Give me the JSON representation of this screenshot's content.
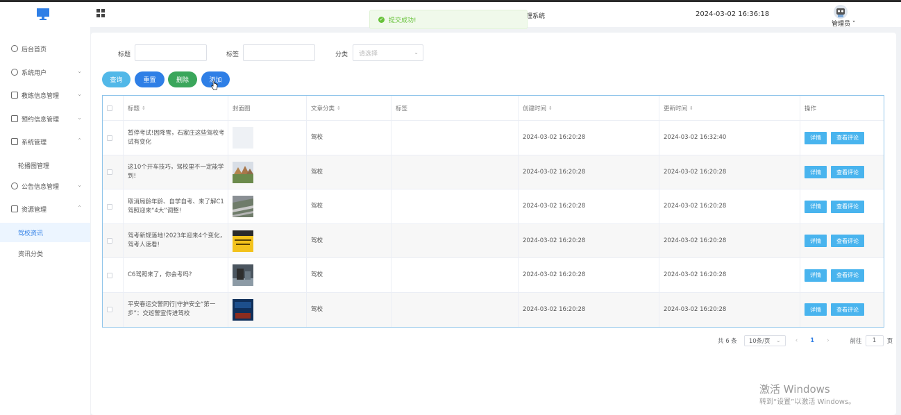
{
  "header": {
    "system_title": "理系统",
    "datetime": "2024-03-02 16:36:18",
    "user_name": "管理员 ˅"
  },
  "toast": {
    "text": "提交成功!"
  },
  "sidebar": {
    "items": [
      {
        "label": "后台首页"
      },
      {
        "label": "系统用户"
      },
      {
        "label": "教练信息管理"
      },
      {
        "label": "预约信息管理"
      },
      {
        "label": "系统管理"
      },
      {
        "label": "公告信息管理"
      },
      {
        "label": "资源管理"
      }
    ],
    "subitems": [
      {
        "label": "轮播图管理"
      },
      {
        "label": "驾校资讯"
      },
      {
        "label": "资讯分类"
      }
    ]
  },
  "filters": {
    "title_label": "标题",
    "tag_label": "标签",
    "category_label": "分类",
    "category_placeholder": "请选择"
  },
  "actions": {
    "query": "查询",
    "reset": "重置",
    "delete": "删除",
    "add": "添加"
  },
  "table": {
    "headers": {
      "title": "标题",
      "cover": "封面图",
      "category": "文章分类",
      "tags": "标签",
      "created": "创建时间",
      "updated": "更新时间",
      "ops": "操作"
    },
    "sort_icon": "⇕",
    "rows": [
      {
        "title": "暂停考试!因降雪，石家庄这些驾校考试有变化",
        "category": "驾校",
        "tags": "",
        "created": "2024-03-02 16:20:28",
        "updated": "2024-03-02 16:32:40",
        "detail": "详情",
        "comment": "查看评论"
      },
      {
        "title": "这10个开车技巧，驾校里不一定能学到!",
        "category": "驾校",
        "tags": "",
        "created": "2024-03-02 16:20:28",
        "updated": "2024-03-02 16:20:28",
        "detail": "详情",
        "comment": "查看评论"
      },
      {
        "title": "取消局龄年龄、自学自考、来了解C1驾照迎来“4大”调整!",
        "category": "驾校",
        "tags": "",
        "created": "2024-03-02 16:20:28",
        "updated": "2024-03-02 16:20:28",
        "detail": "详情",
        "comment": "查看评论"
      },
      {
        "title": "驾考新规落地!2023年迎来4个变化，驾考人速看!",
        "category": "驾校",
        "tags": "",
        "created": "2024-03-02 16:20:28",
        "updated": "2024-03-02 16:20:28",
        "detail": "详情",
        "comment": "查看评论"
      },
      {
        "title": "C6驾照来了，你会考吗?",
        "category": "驾校",
        "tags": "",
        "created": "2024-03-02 16:20:28",
        "updated": "2024-03-02 16:20:28",
        "detail": "详情",
        "comment": "查看评论"
      },
      {
        "title": "平安春运交警同行|守护安全“第一步”：交巡警宣传进驾校",
        "category": "驾校",
        "tags": "",
        "created": "2024-03-02 16:20:28",
        "updated": "2024-03-02 16:20:28",
        "detail": "详情",
        "comment": "查看评论"
      }
    ]
  },
  "pagination": {
    "total": "共 6 条",
    "page_size": "10条/页",
    "current": "1",
    "goto_label": "前往",
    "goto_value": "1",
    "page_unit": "页"
  },
  "watermark": {
    "line1": "激活 Windows",
    "line2": "转到“设置”以激活 Windows。"
  },
  "colors": {
    "primary": "#2f7fe6",
    "query": "#52b8e8",
    "delete": "#3aa65b",
    "op_button": "#49b4ee",
    "success": "#67c23a"
  }
}
